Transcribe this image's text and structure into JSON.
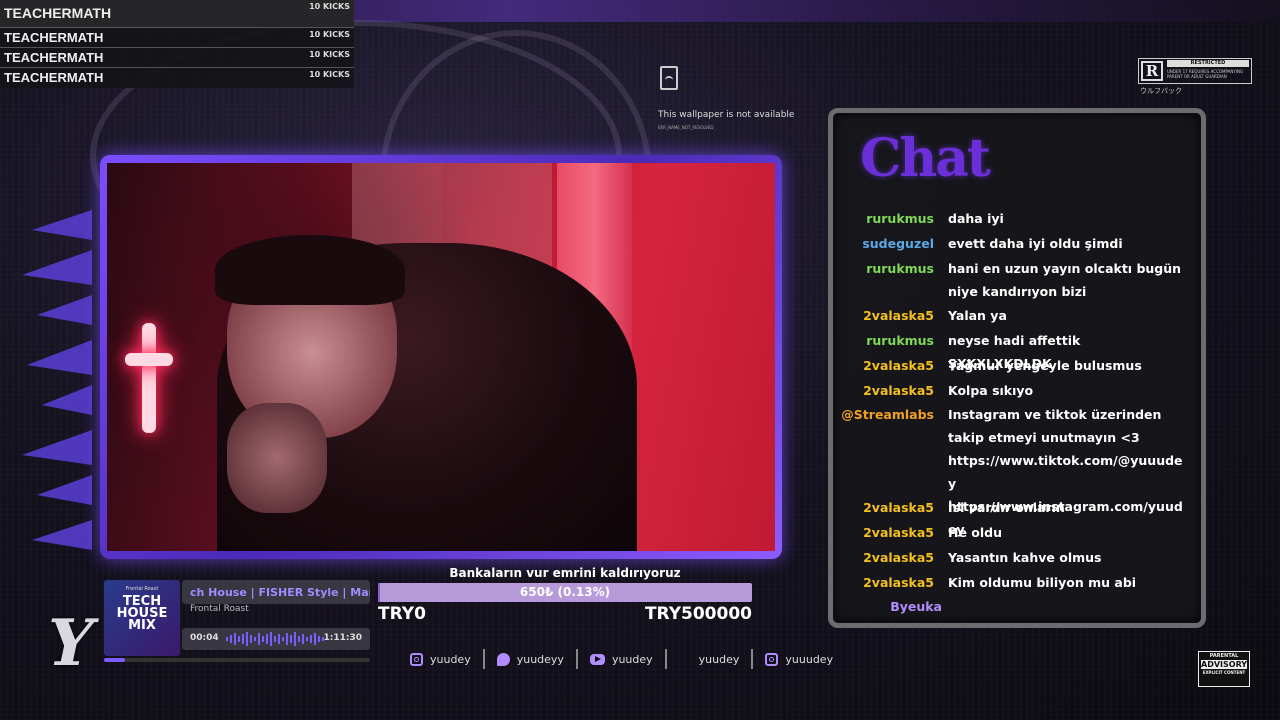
{
  "kicks": [
    {
      "name": "TEACHERMATH",
      "count": "10 KICKS"
    },
    {
      "name": "TEACHERMATH",
      "count": "10 KICKS"
    },
    {
      "name": "TEACHERMATH",
      "count": "10 KICKS"
    },
    {
      "name": "TEACHERMATH",
      "count": "10 KICKS"
    }
  ],
  "wallpaper": {
    "message": "This wallpaper is not available",
    "error_code": "ERR_NAME_NOT_RESOLVED"
  },
  "rating": {
    "letter": "R",
    "header": "RESTRICTED",
    "small": "UNDER 17 REQUIRES ACCOMPANYING PARENT OR ADULT GUARDIAN",
    "sub": "ウルフバック"
  },
  "chat": {
    "title": "Chat",
    "messages": [
      {
        "user": "rurukmus",
        "color": "#7ed957",
        "text": "daha iyi"
      },
      {
        "user": "sudeguzel",
        "color": "#5aa9e6",
        "text": "evett daha iyi oldu şimdi"
      },
      {
        "user": "rurukmus",
        "color": "#7ed957",
        "text": "hani en uzun yayın olcaktı bugün niye kandırıyon bizi"
      },
      {
        "user": "2valaska5",
        "color": "#f4c020",
        "text": "Yalan ya"
      },
      {
        "user": "rurukmus",
        "color": "#7ed957",
        "text": "neyse hadi affettik ŞXKXLXKDLDK"
      },
      {
        "user": "2valaska5",
        "color": "#f4c020",
        "text": "Yağmur yengeyle bulusmus"
      },
      {
        "user": "2valaska5",
        "color": "#f4c020",
        "text": "Kolpa sıkıyo"
      },
      {
        "user": "@Streamlabs",
        "color": "#f2a024",
        "text": "Instagram ve tiktok üzerinden takip etmeyi unutmayın <3 https://www.tiktok.com/@yuuudey https://www.instagram.com/yuudey"
      },
      {
        "user": "2valaska5",
        "color": "#f4c020",
        "text": "İsi vardır onların"
      },
      {
        "user": "2valaska5",
        "color": "#f4c020",
        "text": "He oldu"
      },
      {
        "user": "2valaska5",
        "color": "#f4c020",
        "text": "Yasantın kahve olmus"
      },
      {
        "user": "2valaska5",
        "color": "#f4c020",
        "text": "Kim oldumu biliyon mu abi"
      },
      {
        "user": "Byeuka",
        "color": "#b48cff",
        "text": ""
      }
    ]
  },
  "music": {
    "art_top": "Frontal Roast",
    "art_title": "TECH HOUSE MIX",
    "title": "ch House | FISHER Style | Marc",
    "artist": "Frontal Roast",
    "elapsed": "00:04",
    "duration": "1:11:30",
    "progress": 0.08
  },
  "goal": {
    "title": "Bankaların vur emrini kaldırıyoruz",
    "amount_label": "650₺ (0.13%)",
    "progress": 0.0013,
    "min_label": "TRY0",
    "max_label": "TRY500000"
  },
  "socials": [
    {
      "icon": "instagram-icon",
      "handle": "yuudey"
    },
    {
      "icon": "twitter-icon",
      "handle": "yuudeyy"
    },
    {
      "icon": "youtube-icon",
      "handle": "yuudey"
    },
    {
      "icon": "tiktok-icon",
      "handle": "yuudey"
    },
    {
      "icon": "instagram-icon",
      "handle": "yuuudey"
    }
  ],
  "logo": {
    "letter": "Y"
  },
  "advisory": {
    "line1": "PARENTAL",
    "line2": "ADVISORY",
    "line3": "EXPLICIT CONTENT"
  }
}
